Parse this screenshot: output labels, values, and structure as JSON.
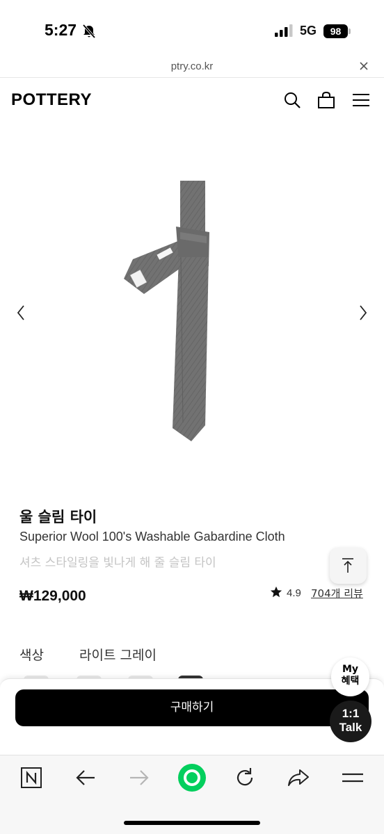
{
  "status_bar": {
    "time": "5:27",
    "network": "5G",
    "battery": "98"
  },
  "browser": {
    "url": "ptry.co.kr"
  },
  "site": {
    "logo": "POTTERY"
  },
  "product": {
    "name": "울 슬림 타이",
    "subtitle": "Superior Wool 100's Washable Gabardine Cloth",
    "description": "셔츠 스타일링을 빛나게 해 줄 슬림 타이",
    "price": "₩129,000",
    "rating": "4.9",
    "review_link": "704개 리뷰",
    "color_label": "색상",
    "color_value": "라이트 그레이"
  },
  "purchase": {
    "buy_label": "구매하기"
  },
  "floating": {
    "my_benefit_line1": "My",
    "my_benefit_line2": "혜택",
    "talk_line1": "1:1",
    "talk_line2": "Talk"
  },
  "icons": {
    "header": [
      "search-icon",
      "bag-icon",
      "menu-icon"
    ],
    "toolbar": [
      "naver-n-icon",
      "back-arrow-icon",
      "forward-arrow-icon",
      "green-home-icon",
      "reload-icon",
      "share-icon",
      "menu-icon"
    ]
  },
  "colors": {
    "brand_black": "#000000",
    "naver_green": "#03cf5d",
    "tie_gray": "#707070"
  }
}
